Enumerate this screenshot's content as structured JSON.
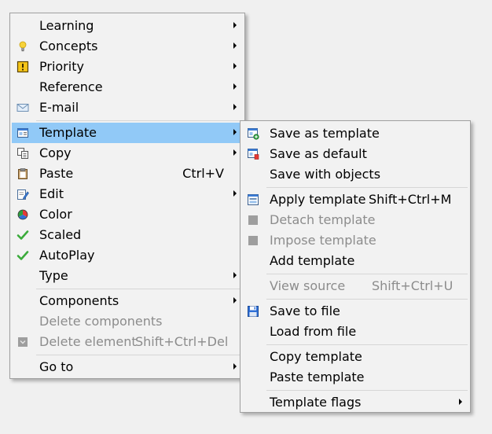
{
  "main_menu": {
    "learning": "Learning",
    "concepts": "Concepts",
    "priority": "Priority",
    "reference": "Reference",
    "email": "E-mail",
    "template": "Template",
    "copy": "Copy",
    "paste": "Paste",
    "paste_shortcut": "Ctrl+V",
    "edit": "Edit",
    "color": "Color",
    "scaled": "Scaled",
    "autoplay": "AutoPlay",
    "type": "Type",
    "components": "Components",
    "delete_components": "Delete components",
    "delete_element": "Delete element",
    "delete_element_shortcut": "Shift+Ctrl+Del",
    "go_to": "Go to"
  },
  "sub_menu": {
    "save_as_template": "Save as template",
    "save_as_default": "Save as default",
    "save_with_objects": "Save with objects",
    "apply_template": "Apply template",
    "apply_template_shortcut": "Shift+Ctrl+M",
    "detach_template": "Detach template",
    "impose_template": "Impose template",
    "add_template": "Add template",
    "view_source": "View source",
    "view_source_shortcut": "Shift+Ctrl+U",
    "save_to_file": "Save to file",
    "load_from_file": "Load from file",
    "copy_template": "Copy template",
    "paste_template": "Paste template",
    "template_flags": "Template flags"
  },
  "icons": {
    "concepts": "lightbulb-icon",
    "priority": "priority-icon",
    "email": "envelope-icon",
    "template": "template-window-icon",
    "copy": "copy-icon",
    "paste": "clipboard-icon",
    "edit": "edit-pencil-icon",
    "color": "color-wheel-icon",
    "scaled": "checkmark-icon",
    "autoplay": "checkmark-icon",
    "delete_element": "delete-element-icon",
    "save_as_template": "save-template-icon",
    "save_as_default": "save-default-icon",
    "apply_template": "apply-template-icon",
    "detach_template": "detach-template-icon",
    "impose_template": "impose-template-icon",
    "save_to_file": "floppy-disk-icon"
  },
  "colors": {
    "menu_background": "#f2f2f2",
    "highlight": "#91c9f7",
    "disabled_text": "#8c8c8c",
    "separator": "#d6d6d6"
  }
}
